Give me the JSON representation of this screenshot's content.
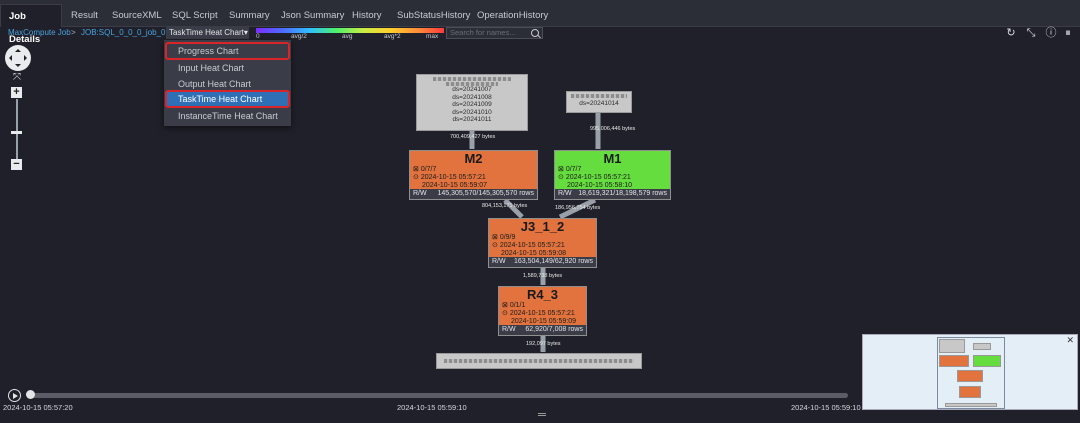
{
  "tabs": [
    "Job Details",
    "Result",
    "SourceXML",
    "SQL Script",
    "Summary",
    "Json Summary",
    "History",
    "SubStatusHistory",
    "OperationHistory"
  ],
  "breadcrumb": {
    "job": "MaxCompute Job",
    "separator": ">",
    "instance": "JOB:SQL_0_0_0_job_0"
  },
  "chart_selector": {
    "value": "TaskTime Heat Chart▾"
  },
  "heat_legend": {
    "min": "0",
    "avg_half": "avg/2",
    "avg": "avg",
    "avg_double": "avg*2",
    "max": "max"
  },
  "search": {
    "placeholder": "Search for names..."
  },
  "menu": {
    "items": [
      "Progress Chart",
      "Input Heat Chart",
      "Output Heat Chart",
      "TaskTime Heat Chart",
      "InstanceTime Heat Chart"
    ],
    "selected": "TaskTime Heat Chart"
  },
  "sources": {
    "left": {
      "partitions": [
        "ds=20241007",
        "ds=20241008",
        "ds=20241009",
        "ds=20241010",
        "ds=20241011"
      ]
    },
    "right": {
      "partitions": [
        "ds=20241014"
      ]
    }
  },
  "edge_labels": {
    "left_to_m2": "700,409,427 bytes",
    "right_to_m1": "995,006,446 bytes",
    "m2_to_j3": "804,153,171 bytes",
    "m1_to_j3": "186,956,754 bytes",
    "j3_to_r4": "1,589,738 bytes",
    "r4_to_sink": "192,097 bytes"
  },
  "nodes": {
    "m2": {
      "name": "M2",
      "progress": "0/7/7",
      "start": "2024-10-15 05:57:21",
      "end": "2024-10-15 05:59:07",
      "rw_label": "R/W",
      "rows": "145,305,570/145,305,570 rows",
      "color": "#e2733e"
    },
    "m1": {
      "name": "M1",
      "progress": "0/7/7",
      "start": "2024-10-15 05:57:21",
      "end": "2024-10-15 05:58:10",
      "rw_label": "R/W",
      "rows": "18,619,321/18,198,579 rows",
      "color": "#66dd3e"
    },
    "j3": {
      "name": "J3_1_2",
      "progress": "0/9/9",
      "start": "2024-10-15 05:57:21",
      "end": "2024-10-15 05:59:08",
      "rw_label": "R/W",
      "rows": "163,504,149/62,920 rows",
      "color": "#e2733e"
    },
    "r4": {
      "name": "R4_3",
      "progress": "0/1/1",
      "start": "2024-10-15 05:57:21",
      "end": "2024-10-15 05:59:09",
      "rw_label": "R/W",
      "rows": "62,920/7,008 rows",
      "color": "#e2733e"
    }
  },
  "icons": {
    "progress_icon": "⊠",
    "time_icon": "⊙"
  },
  "timeline": {
    "start": "2024-10-15 05:57:20",
    "mid": "2024-10-15 05:59:10",
    "end": "2024-10-15 05:59:10"
  }
}
